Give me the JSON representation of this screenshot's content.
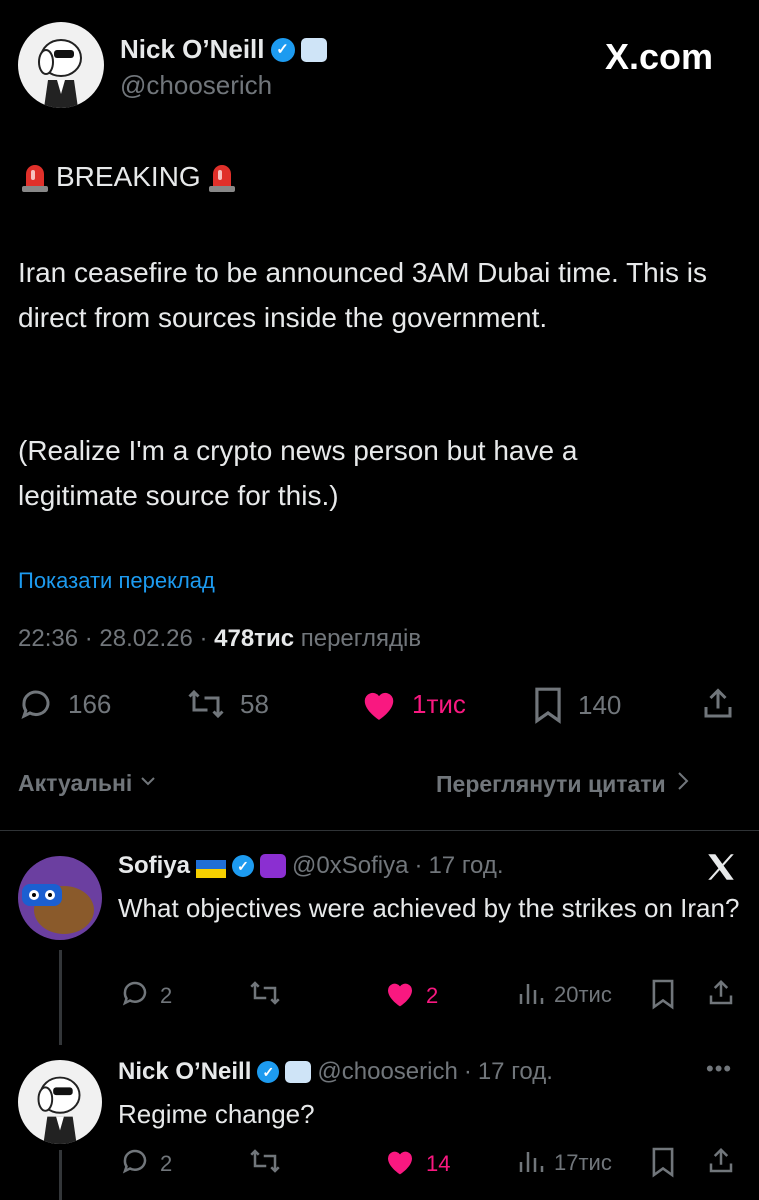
{
  "post": {
    "author_name": "Nick O’Neill",
    "author_handle": "@chooserich",
    "site_label": "X.com",
    "breaking_label": "BREAKING",
    "body_p1": "Iran ceasefire to be announced 3AM Dubai time. This is direct from sources inside the government.",
    "body_p2": "(Realize I'm a crypto news person but have a legitimate source for this.)",
    "translate_link": "Показати переклад",
    "time": "22:36",
    "date": "28.02.26",
    "views_count": "478тис",
    "views_label": "переглядів",
    "replies": "166",
    "reposts": "58",
    "likes": "1тис",
    "bookmarks": "140"
  },
  "sort": {
    "relevant_label": "Актуальні",
    "view_quotes_label": "Переглянути цитати"
  },
  "replies": [
    {
      "author_name": "Sofiya",
      "author_handle": "@0xSofiya",
      "time_ago": "17 год.",
      "text": "What objectives were achieved by the strikes on Iran?",
      "replies": "2",
      "likes": "2",
      "views": "20тис"
    },
    {
      "author_name": "Nick O’Neill",
      "author_handle": "@chooserich",
      "time_ago": "17 год.",
      "text": "Regime change?",
      "replies": "2",
      "likes": "14",
      "views": "17тис"
    }
  ],
  "colors": {
    "background": "#000000",
    "text": "#e7e9ea",
    "muted": "#71767b",
    "link": "#1d9bf0",
    "like": "#f91880",
    "verified": "#1d9bf0"
  }
}
